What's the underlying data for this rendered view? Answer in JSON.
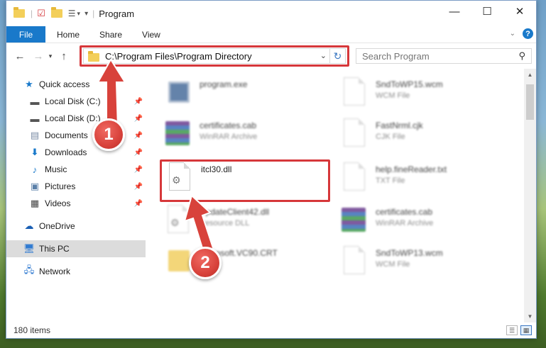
{
  "window": {
    "title": "Program",
    "controls": {
      "minimize": "—",
      "maximize": "☐",
      "close": "✕"
    }
  },
  "ribbon": {
    "tabs": [
      "File",
      "Home",
      "Share",
      "View"
    ],
    "help": "?"
  },
  "address_bar": {
    "path": "C:\\Program Files\\Program Directory",
    "search_placeholder": "Search Program"
  },
  "sidebar": {
    "items": [
      {
        "label": "Quick access",
        "icon": "star-icon",
        "pinned": false
      },
      {
        "label": "Local Disk (C:)",
        "icon": "drive-icon",
        "pinned": true
      },
      {
        "label": "Local Disk (D:)",
        "icon": "drive-icon",
        "pinned": true
      },
      {
        "label": "Documents",
        "icon": "documents-icon",
        "pinned": true
      },
      {
        "label": "Downloads",
        "icon": "download-icon",
        "pinned": true
      },
      {
        "label": "Music",
        "icon": "music-icon",
        "pinned": true
      },
      {
        "label": "Pictures",
        "icon": "pictures-icon",
        "pinned": true
      },
      {
        "label": "Videos",
        "icon": "videos-icon",
        "pinned": true
      },
      {
        "label": "OneDrive",
        "icon": "cloud-icon",
        "pinned": false
      },
      {
        "label": "This PC",
        "icon": "computer-icon",
        "pinned": false,
        "selected": true
      },
      {
        "label": "Network",
        "icon": "network-icon",
        "pinned": false
      }
    ]
  },
  "files": [
    {
      "name": "program.exe",
      "type": "",
      "kind": "exe"
    },
    {
      "name": "SndToWP15.wcm",
      "type": "WCM File",
      "kind": "doc"
    },
    {
      "name": "certificates.cab",
      "type": "WinRAR Archive",
      "kind": "rar"
    },
    {
      "name": "FastNrml.cjk",
      "type": "CJK File",
      "kind": "doc"
    },
    {
      "name": "itcl30.dll",
      "type": "",
      "kind": "dll"
    },
    {
      "name": "help.fineReader.txt",
      "type": "TXT File",
      "kind": "doc"
    },
    {
      "name": "UpdateClient42.dll",
      "type": "Resource DLL",
      "kind": "dll"
    },
    {
      "name": "certificates.cab",
      "type": "WinRAR Archive",
      "kind": "rar"
    },
    {
      "name": "Microsoft.VC90.CRT",
      "type": "",
      "kind": "folder"
    },
    {
      "name": "SndToWP13.wcm",
      "type": "WCM File",
      "kind": "doc"
    }
  ],
  "status": {
    "item_count": "180 items"
  },
  "markers": {
    "step1": "1",
    "step2": "2"
  },
  "colors": {
    "accent": "#1979ca",
    "highlight": "#d6373a"
  }
}
